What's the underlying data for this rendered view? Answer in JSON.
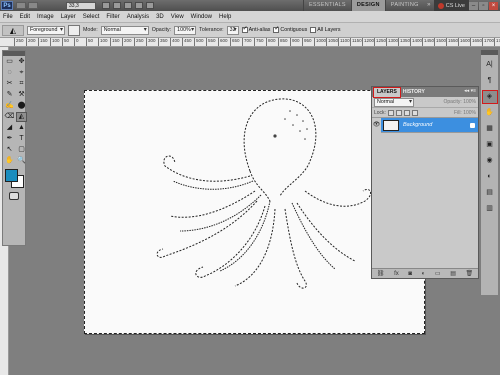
{
  "app": {
    "logo": "Ps",
    "zoom": "33,3",
    "workspaces": [
      "ESSENTIALS",
      "DESIGN",
      "PAINTING"
    ],
    "active_workspace": "DESIGN",
    "more": "»",
    "cs_live": "CS Live"
  },
  "menu": [
    "File",
    "Edit",
    "Image",
    "Layer",
    "Select",
    "Filter",
    "Analysis",
    "3D",
    "View",
    "Window",
    "Help"
  ],
  "options": {
    "source": "Foreground",
    "mode_label": "Mode:",
    "mode_value": "Normal",
    "opacity_label": "Opacity:",
    "opacity_value": "100%",
    "tolerance_label": "Tolerance:",
    "tolerance_value": "32",
    "antialias_label": "Anti-alias",
    "contiguous_label": "Contiguous",
    "all_layers_label": "All Layers"
  },
  "ruler": [
    "250",
    "200",
    "150",
    "100",
    "50",
    "0",
    "50",
    "100",
    "150",
    "200",
    "250",
    "300",
    "350",
    "400",
    "450",
    "500",
    "550",
    "600",
    "650",
    "700",
    "750",
    "800",
    "850",
    "900",
    "950",
    "1000",
    "1050",
    "1100",
    "1150",
    "1200",
    "1250",
    "1300",
    "1350",
    "1400",
    "1450",
    "1500",
    "1550",
    "1600",
    "1650",
    "1700",
    "1750"
  ],
  "layers_panel": {
    "tab_layers": "LAYERS",
    "tab_history": "HISTORY",
    "tab_ctrls": "◂◂ ▾≡",
    "blend_mode": "Normal",
    "opacity": "Opacity: 100%",
    "lock": "Lock:",
    "fill": "Fill: 100%",
    "layer_name": "Background",
    "footer_icons": [
      "⛓",
      "fx",
      "◙",
      "◐",
      "▭",
      "▤",
      "🗑"
    ]
  },
  "tool_glyphs": [
    "▭",
    "✥",
    "◌",
    "⌖",
    "✂",
    "⌗",
    "✎",
    "⚒",
    "✍",
    "⬤",
    "⌫",
    "◭",
    "◢",
    "▲",
    "✒",
    "T",
    "↖",
    "▢",
    "✋",
    "🔍"
  ],
  "strip1_glyphs": [
    "A|",
    "¶",
    "◈",
    "✋",
    "▦",
    "▣",
    "◉",
    "◐",
    "▤",
    "▥"
  ],
  "colors": {
    "foreground": "#1b8dbe",
    "background": "#ffffff",
    "highlight": "#d11a1a",
    "selection": "#3c8fe0"
  }
}
